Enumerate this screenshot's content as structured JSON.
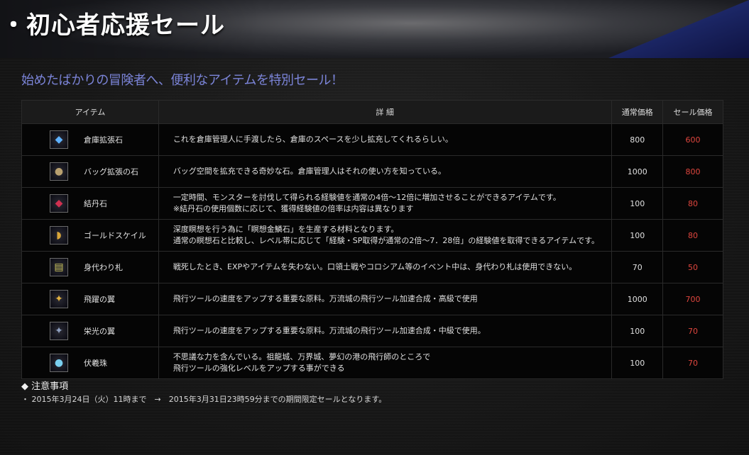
{
  "banner": {
    "title": "・初心者応援セール"
  },
  "lead": "始めたばかりの冒険者へ、便利なアイテムを特別セール！",
  "table": {
    "headers": {
      "item": "アイテム",
      "detail": "詳 細",
      "normal": "通常価格",
      "sale": "セール価格"
    },
    "rows": [
      {
        "name": "倉庫拡張石",
        "icon": "blue-crystal-icon",
        "icon_color": "#5fb2ff",
        "detail": "これを倉庫管理人に手渡したら、倉庫のスペースを少し拡充してくれるらしい。",
        "normal": "800",
        "sale": "600"
      },
      {
        "name": "バッグ拡張の石",
        "icon": "skull-stone-icon",
        "icon_color": "#b8a070",
        "detail": "バッグ空間を拡充できる奇妙な石。倉庫管理人はそれの使い方を知っている。",
        "normal": "1000",
        "sale": "800"
      },
      {
        "name": "結丹石",
        "icon": "red-gem-icon",
        "icon_color": "#d03050",
        "detail": "一定時間、モンスターを討伐して得られる経験値を通常の4倍～12倍に増加させることができるアイテムです。\n※結丹石の使用個数に応じて、獲得経験値の倍率は内容は異なります",
        "normal": "100",
        "sale": "80"
      },
      {
        "name": "ゴールドスケイル",
        "icon": "gold-scale-icon",
        "icon_color": "#d9a63a",
        "detail": "深度瞑想を行う為に「瞑想金鱗石」を生産する材料となります。\n通常の瞑想石と比較し、レベル帯に応じて「経験・SP取得が通常の2倍～7．28倍」の経験値を取得できるアイテムです。",
        "normal": "100",
        "sale": "80"
      },
      {
        "name": "身代わり札",
        "icon": "talisman-icon",
        "icon_color": "#c9c25a",
        "detail": "戦死したとき、EXPやアイテムを失わない。口領土戦やコロシアム等のイベント中は、身代わり札は使用できない。",
        "normal": "70",
        "sale": "50"
      },
      {
        "name": "飛躍の翼",
        "icon": "golden-wing-icon",
        "icon_color": "#e0b040",
        "detail": "飛行ツールの速度をアップする重要な原料。万流城の飛行ツール加速合成・高級で使用",
        "normal": "1000",
        "sale": "700"
      },
      {
        "name": "栄光の翼",
        "icon": "silver-wing-icon",
        "icon_color": "#8fa0c0",
        "detail": "飛行ツールの速度をアップする重要な原料。万流城の飛行ツール加速合成・中級で使用。",
        "normal": "100",
        "sale": "70"
      },
      {
        "name": "伏羲珠",
        "icon": "orb-icon",
        "icon_color": "#7ad0f0",
        "detail": "不思議な力を含んでいる。祖龍城、万界城、夢幻の港の飛行師のところで\n飛行ツールの強化レベルをアップする事ができる",
        "normal": "100",
        "sale": "70"
      }
    ]
  },
  "notes": {
    "heading": "◆ 注意事項",
    "line": "・ 2015年3月24日（火）11時まで　→　2015年3月31日23時59分までの期間限定セールとなります。"
  },
  "colors": {
    "lead": "#7b84d8",
    "sale_price": "#e0463e"
  }
}
